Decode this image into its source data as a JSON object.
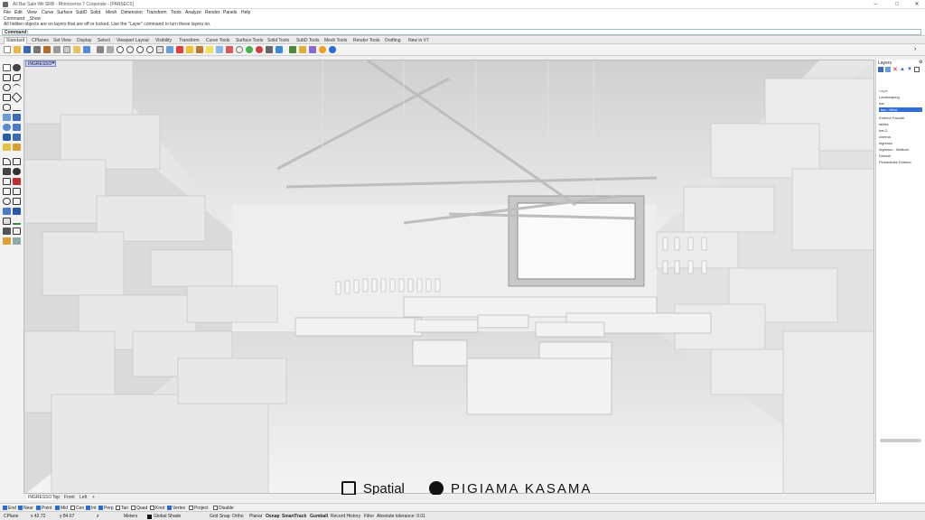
{
  "window": {
    "title": "All Bar Sale Wil SRB - Rhinoceros 7 Corporate - [PARSEC0]"
  },
  "menu": [
    "File",
    "Edit",
    "View",
    "Curve",
    "Surface",
    "SubD",
    "Solid",
    "Mesh",
    "Dimension",
    "Transform",
    "Tools",
    "Analyze",
    "Render",
    "Panels",
    "Help"
  ],
  "command": {
    "history1": "Command: _Show",
    "history2": "All hidden objects are on layers that are off or locked.  Use the \"Layer\" command to turn these layers on.",
    "prompt": "Command:"
  },
  "toolbar_tabs": [
    "Standard",
    "CPlanes",
    "Set View",
    "Display",
    "Select",
    "Viewport Layout",
    "Visibility",
    "Transform",
    "Curve Tools",
    "Surface Tools",
    "Solid Tools",
    "SubD Tools",
    "Mesh Tools",
    "Render Tools",
    "Drafting",
    "New in V7"
  ],
  "viewport": {
    "label": "INGRESSO*"
  },
  "view_tabs": [
    "INGRESSO",
    "Top",
    "Front",
    "Left",
    "+"
  ],
  "osnaps": [
    {
      "label": "End",
      "on": true
    },
    {
      "label": "Near",
      "on": true
    },
    {
      "label": "Point",
      "on": true
    },
    {
      "label": "Mid",
      "on": true
    },
    {
      "label": "Cen",
      "on": false
    },
    {
      "label": "Int",
      "on": true
    },
    {
      "label": "Perp",
      "on": true
    },
    {
      "label": "Tan",
      "on": false
    },
    {
      "label": "Quad",
      "on": false
    },
    {
      "label": "Knot",
      "on": false
    },
    {
      "label": "Vertex",
      "on": true
    },
    {
      "label": "Project",
      "on": false
    },
    {
      "label": "Disable",
      "on": false
    }
  ],
  "status": {
    "cplane": "CPlane",
    "x": "x 42.72",
    "y": "y 84.67",
    "z": "z",
    "units": "Meters",
    "layer": "Global Shade",
    "items": [
      "Grid Snap",
      "Ortho",
      "Planar",
      "Osnap",
      "SmartTrack",
      "Gumball",
      "Record History",
      "Filter",
      "Absolute tolerance: 0.01"
    ],
    "bold_items": [
      "Osnap",
      "SmartTrack",
      "Gumball"
    ]
  },
  "layers_panel": {
    "title": "Layers",
    "header": "Layer",
    "items": [
      {
        "label": "Landscaping",
        "selected": false
      },
      {
        "label": "bar",
        "selected": false
      },
      {
        "label": "bar - Wrist",
        "selected": true
      },
      {
        "label": "Exterior Facade",
        "selected": false
      },
      {
        "label": "tables",
        "selected": false
      },
      {
        "label": "bar-2",
        "selected": false
      },
      {
        "label": "cinema",
        "selected": false
      },
      {
        "label": "ingresso",
        "selected": false
      },
      {
        "label": "Ingresso - Walkout",
        "selected": false
      },
      {
        "label": "Default",
        "selected": false
      },
      {
        "label": "Plumbstrike Exterior",
        "selected": false
      }
    ]
  },
  "branding": {
    "logo1": "Spatial",
    "logo2": "PIGIAMA KASAMA"
  },
  "colors": {
    "accent": "#2f6fd8",
    "viewport_bg": "#ececec"
  }
}
